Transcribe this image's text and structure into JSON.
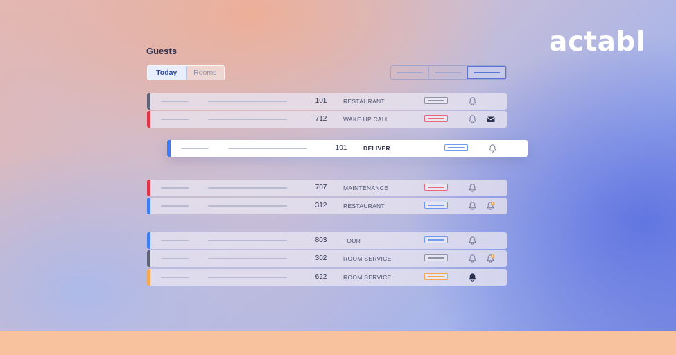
{
  "brand": {
    "logo_text": "actabl"
  },
  "page": {
    "title": "Guests"
  },
  "segment": {
    "today": "Today",
    "rooms": "Rooms"
  },
  "colors": {
    "gray": "#5f6375",
    "red": "#e03448",
    "blue": "#3d7cf2",
    "orange": "#f4a651",
    "status_gray": "#8f93a6",
    "status_red": "#e86a7a",
    "status_blue": "#6f9cf0",
    "status_orange": "#f4a651"
  },
  "rows": [
    {
      "room": "101",
      "type": "RESTAURANT",
      "accent": "gray",
      "status": "gray",
      "bell": "outline",
      "extra": "none"
    },
    {
      "room": "712",
      "type": "WAKE UP CALL",
      "accent": "red",
      "status": "red",
      "bell": "outline",
      "extra": "envelope-icon"
    },
    {
      "room": "101",
      "type": "DELIVER",
      "accent": "blue",
      "status": "blue",
      "bell": "outline",
      "extra": "none",
      "featured": true
    },
    {
      "room": "707",
      "type": "MAINTENANCE",
      "accent": "red",
      "status": "red",
      "bell": "outline",
      "extra": "none"
    },
    {
      "room": "312",
      "type": "RESTAURANT",
      "accent": "blue",
      "status": "blue",
      "bell": "outline",
      "extra": "alert-bell-icon"
    },
    {
      "room": "803",
      "type": "TOUR",
      "accent": "blue",
      "status": "blue",
      "bell": "outline",
      "extra": "none"
    },
    {
      "room": "302",
      "type": "ROOM SERVICE",
      "accent": "gray",
      "status": "gray",
      "bell": "outline",
      "extra": "alert-bell-icon"
    },
    {
      "room": "622",
      "type": "ROOM SERVICE",
      "accent": "orange",
      "status": "orange",
      "bell": "filled",
      "extra": "none"
    }
  ]
}
